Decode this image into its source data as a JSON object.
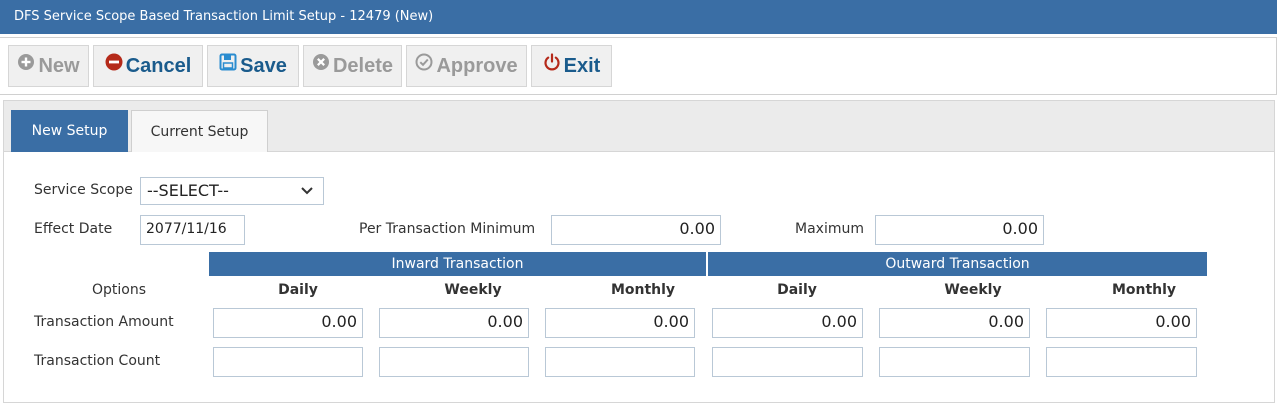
{
  "window": {
    "title": "DFS Service Scope Based Transaction Limit Setup - 12479 (New)"
  },
  "toolbar": {
    "new_label": "New",
    "cancel_label": "Cancel",
    "save_label": "Save",
    "delete_label": "Delete",
    "approve_label": "Approve",
    "exit_label": "Exit"
  },
  "tabs": {
    "new_setup": "New Setup",
    "current_setup": "Current Setup"
  },
  "form": {
    "service_scope_label": "Service Scope",
    "service_scope_value": "--SELECT--",
    "effect_date_label": "Effect Date",
    "effect_date_value": "2077/11/16",
    "per_txn_min_label": "Per Transaction Minimum",
    "per_txn_min_value": "0.00",
    "maximum_label": "Maximum",
    "maximum_value": "0.00"
  },
  "grid": {
    "inward_header": "Inward Transaction",
    "outward_header": "Outward Transaction",
    "options_label": "Options",
    "columns": [
      "Daily",
      "Weekly",
      "Monthly",
      "Daily",
      "Weekly",
      "Monthly"
    ],
    "rows": [
      {
        "label": "Transaction Amount",
        "values": [
          "0.00",
          "0.00",
          "0.00",
          "0.00",
          "0.00",
          "0.00"
        ]
      },
      {
        "label": "Transaction Count",
        "values": [
          "",
          "",
          "",
          "",
          "",
          ""
        ]
      }
    ]
  },
  "colors": {
    "accent": "#3a6ea5",
    "exit_icon": "#b52a1a",
    "cancel_icon": "#b52a1a",
    "save_icon": "#2a8ccf"
  }
}
